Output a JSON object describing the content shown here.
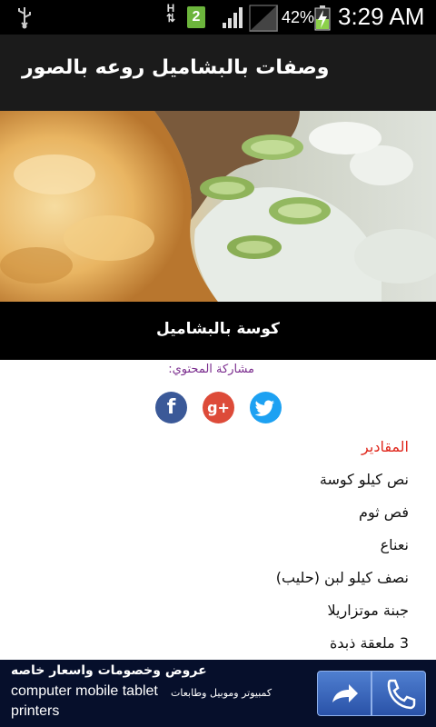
{
  "status_bar": {
    "network_type": "H",
    "sim_slot": "2",
    "battery_percent": "42%",
    "clock": "3:29 AM",
    "icons": [
      "usb-icon",
      "data-arrows-icon",
      "sim-icon",
      "signal-icon",
      "signal-icon",
      "battery-charging-icon"
    ]
  },
  "app_bar": {
    "title": "وصفات بالبشاميل روعه بالصور"
  },
  "hero": {
    "caption": "كوسة بالبشاميل"
  },
  "share": {
    "label": "مشاركة المحتوي:",
    "buttons": [
      {
        "name": "facebook",
        "glyph": "f",
        "color": "#3b5998"
      },
      {
        "name": "google-plus",
        "glyph": "g+",
        "color": "#dd4b39"
      },
      {
        "name": "twitter",
        "glyph": "twitter-bird",
        "color": "#1da1f2"
      }
    ]
  },
  "ingredients": {
    "header": "المقادير",
    "header_color": "#e0281d",
    "items": [
      "نص كيلو كوسة",
      "فص ثوم",
      "نعناع",
      "نصف كيلو لبن (حليب)",
      "جبنة موتزاريلا",
      "3 ملعقة ذبدة"
    ]
  },
  "ad": {
    "title": "عروض وخصومات واسعار خاصه",
    "line1": "computer mobile tablet",
    "line1_arabic": "كمبيوتر وموبيل وطابعات",
    "line2": "printers",
    "buttons": [
      "share-arrow-icon",
      "phone-icon"
    ]
  }
}
